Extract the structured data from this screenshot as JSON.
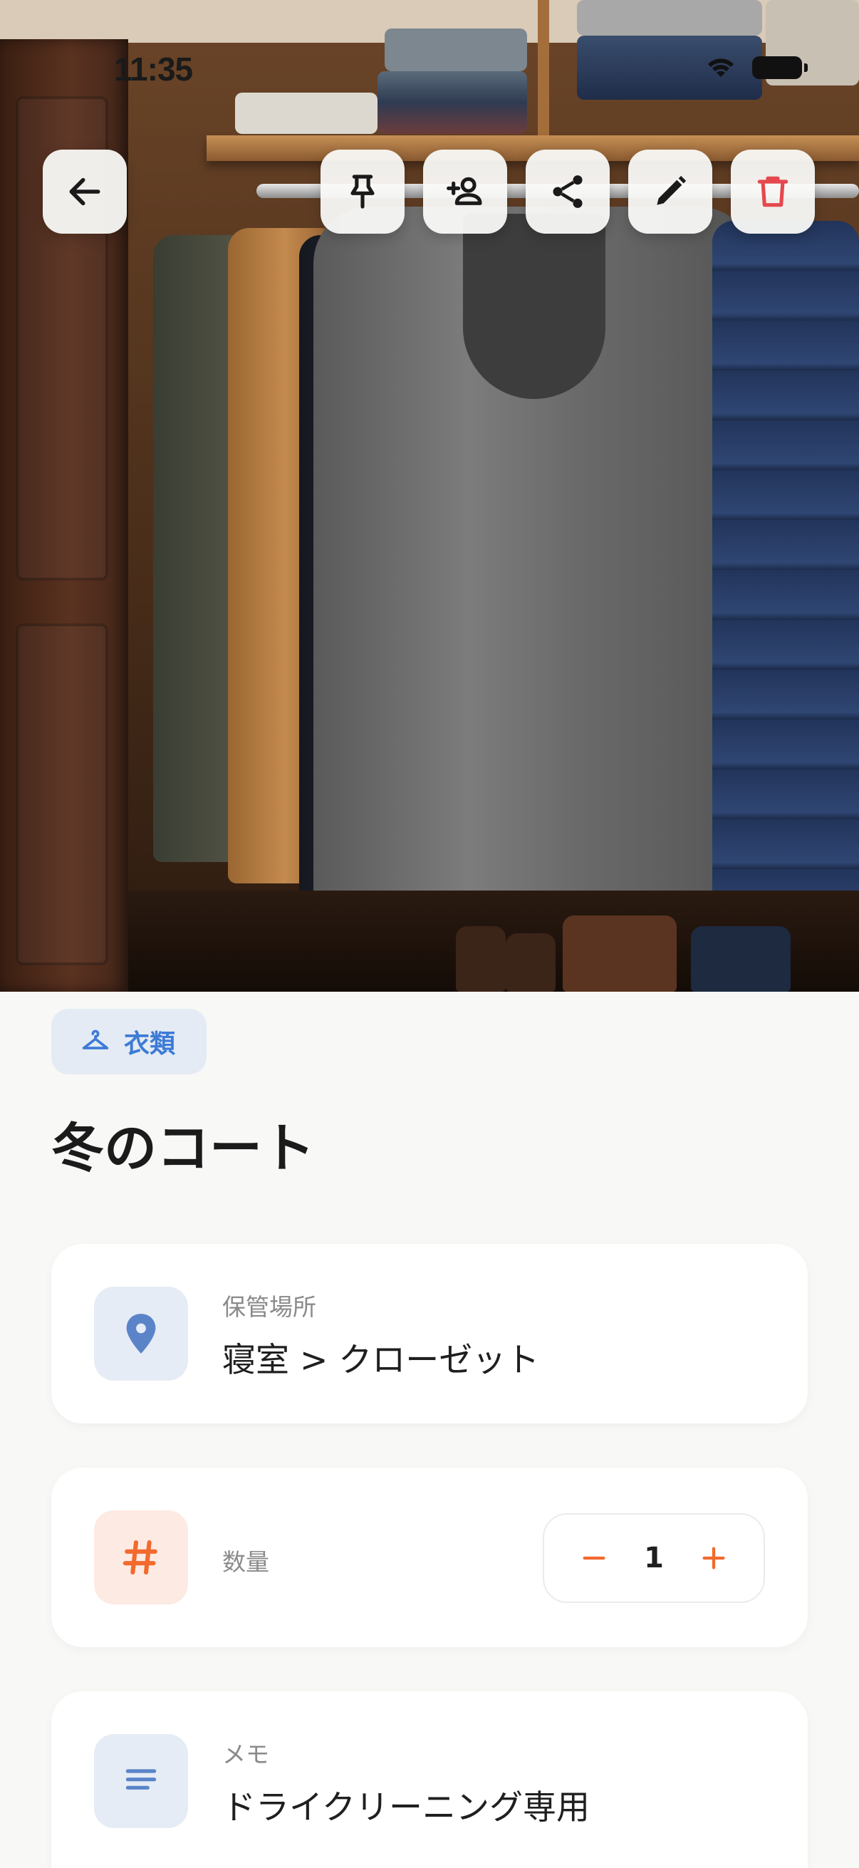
{
  "status_bar": {
    "time": "11:35"
  },
  "toolbar": {
    "back_icon": "arrow-left-icon",
    "actions": [
      {
        "name": "pin",
        "icon": "pin-icon"
      },
      {
        "name": "add-person",
        "icon": "person-add-icon"
      },
      {
        "name": "share",
        "icon": "share-icon"
      },
      {
        "name": "edit",
        "icon": "pencil-icon"
      },
      {
        "name": "delete",
        "icon": "trash-icon",
        "color": "#e5484d"
      }
    ]
  },
  "category": {
    "label": "衣類",
    "icon": "hanger-icon",
    "color": "#3d7bd6"
  },
  "item": {
    "title": "冬のコート"
  },
  "location": {
    "label": "保管場所",
    "value": "寝室 > クローゼット",
    "icon": "location-pin-icon",
    "color": "#5b84c8"
  },
  "quantity": {
    "label": "数量",
    "value": "1",
    "icon": "hash-icon",
    "color": "#f26a2e"
  },
  "memo": {
    "label": "メモ",
    "value": "ドライクリーニング専用",
    "icon": "notes-lines-icon",
    "color": "#5b84c8"
  }
}
